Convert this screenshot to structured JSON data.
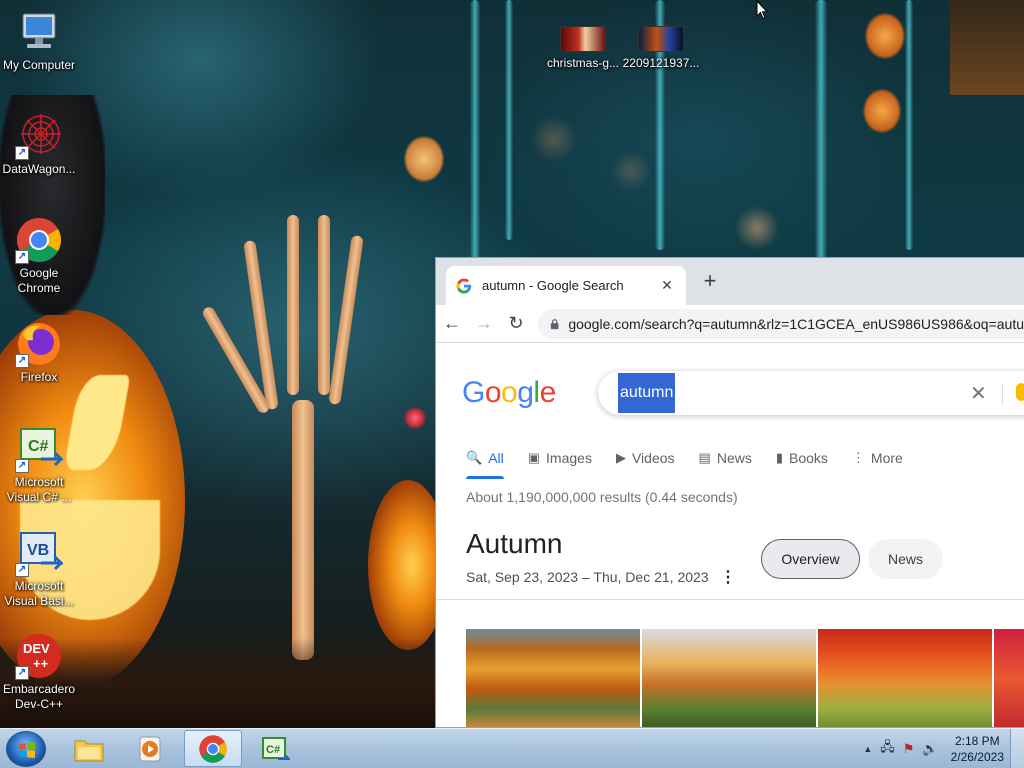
{
  "desktop": {
    "icons": [
      {
        "label": "My Computer",
        "icon": "computer-icon"
      },
      {
        "label": "DataWagon...",
        "icon": "spider-web-icon"
      },
      {
        "label": "Google Chrome",
        "icon": "chrome-icon"
      },
      {
        "label": "Firefox",
        "icon": "firefox-icon"
      },
      {
        "label": "Microsoft Visual C# ...",
        "icon": "csharp-icon"
      },
      {
        "label": "Microsoft Visual Basi...",
        "icon": "vb-icon"
      },
      {
        "label": "Embarcadero Dev-C++",
        "icon": "devcpp-icon"
      }
    ],
    "files": [
      {
        "label": "christmas-g...",
        "icon": "image-thumbnail-icon"
      },
      {
        "label": "2209121937...",
        "icon": "image-thumbnail-icon"
      }
    ]
  },
  "browser": {
    "tab_title": "autumn - Google Search",
    "tab_close": "✕",
    "new_tab": "+",
    "url": "google.com/search?q=autumn&rlz=1C1GCEA_enUS986US986&oq=autu",
    "search_query": "autumn",
    "clear_symbol": "✕",
    "search_tabs": [
      {
        "label": "All",
        "icon": "🔍"
      },
      {
        "label": "Images",
        "icon": "▣"
      },
      {
        "label": "Videos",
        "icon": "▶"
      },
      {
        "label": "News",
        "icon": "▤"
      },
      {
        "label": "Books",
        "icon": "▮"
      },
      {
        "label": "More",
        "icon": "⋮"
      }
    ],
    "results_stats": "About 1,190,000,000 results (0.44 seconds)",
    "knowledge_panel": {
      "title": "Autumn",
      "dates": "Sat, Sep 23, 2023 – Thu, Dec 21, 2023",
      "menu": "⋮",
      "chips": [
        "Overview",
        "News"
      ]
    }
  },
  "taskbar": {
    "pinned": [
      "explorer-icon",
      "media-player-icon",
      "chrome-icon",
      "csharp-icon"
    ],
    "time": "2:18 PM",
    "date": "2/26/2023",
    "tray_icons": [
      "▲",
      "🖧",
      "⚑",
      "🔊"
    ]
  },
  "colors": {
    "google_blue": "#4285f4",
    "google_red": "#ea4335",
    "google_yellow": "#fbbc05",
    "google_green": "#34a853",
    "link_blue": "#1a73e8",
    "selection": "#3367d6"
  }
}
